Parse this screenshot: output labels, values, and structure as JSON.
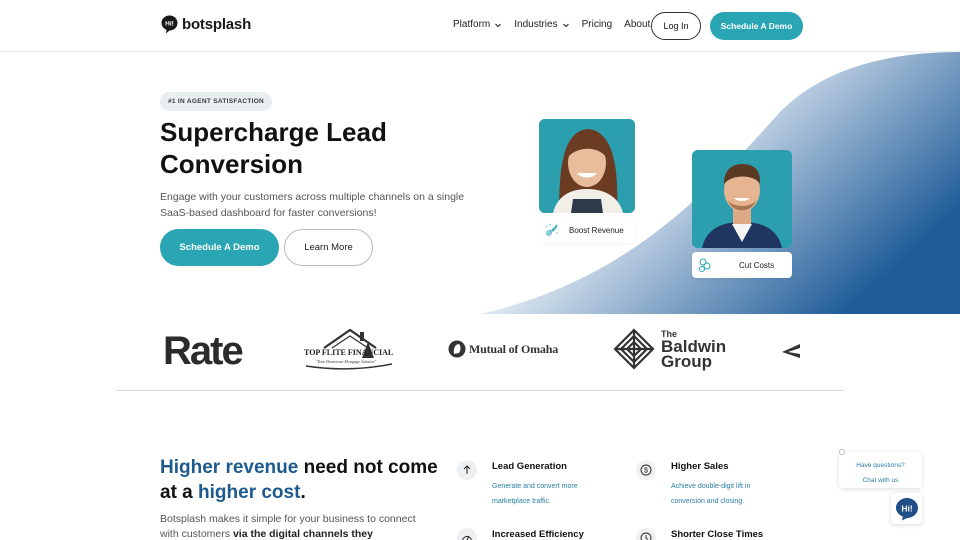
{
  "header": {
    "brand": "botsplash",
    "nav": [
      {
        "label": "Platform",
        "has_dropdown": true
      },
      {
        "label": "Industries",
        "has_dropdown": true
      },
      {
        "label": "Pricing",
        "has_dropdown": false
      },
      {
        "label": "About",
        "has_dropdown": false
      }
    ],
    "login_label": "Log In",
    "demo_label": "Schedule A Demo"
  },
  "hero": {
    "badge": "#1 IN AGENT SATISFACTION",
    "title": "Supercharge Lead Conversion",
    "subtitle": "Engage with your customers across multiple channels on a single SaaS-based dashboard for faster conversions!",
    "primary_cta": "Schedule A Demo",
    "secondary_cta": "Learn More",
    "tags": [
      {
        "label": "Boost Revenue",
        "icon": "rocket-icon"
      },
      {
        "label": "Cut Costs",
        "icon": "coins-icon"
      }
    ]
  },
  "logos": {
    "rate": "Rate",
    "topflite_line1": "TOP FLITE FINANCIAL",
    "topflite_line2": "\"Your Hometown Mortgage Solution\"",
    "mutual": "Mutual of Omaha",
    "baldwin_the": "The",
    "baldwin_line1": "Baldwin",
    "baldwin_line2": "Group"
  },
  "revenue": {
    "title_hl1": "Higher revenue",
    "title_mid": " need not come at a ",
    "title_hl2": "higher cost",
    "title_end": ".",
    "sub_start": "Botsplash makes it simple for your business to connect with customers ",
    "sub_bold": "via the digital channels they"
  },
  "features": [
    {
      "title": "Lead Generation",
      "desc": "Generate and convert more marketplace traffic.",
      "icon": "arrow-up-icon"
    },
    {
      "title": "Higher Sales",
      "desc": "Achieve double-digit lift in conversion and closing.",
      "icon": "dollar-icon"
    },
    {
      "title": "Increased Efficiency",
      "desc": "",
      "icon": "gauge-icon"
    },
    {
      "title": "Shorter Close Times",
      "desc": "",
      "icon": "clock-icon"
    }
  ],
  "chat": {
    "line1": "Have questions?",
    "line2": "Chat with us",
    "button_text": "Hi!"
  },
  "colors": {
    "accent": "#2aa5b4",
    "highlight_blue": "#1d5a8e",
    "link_blue": "#2a7fa5"
  }
}
